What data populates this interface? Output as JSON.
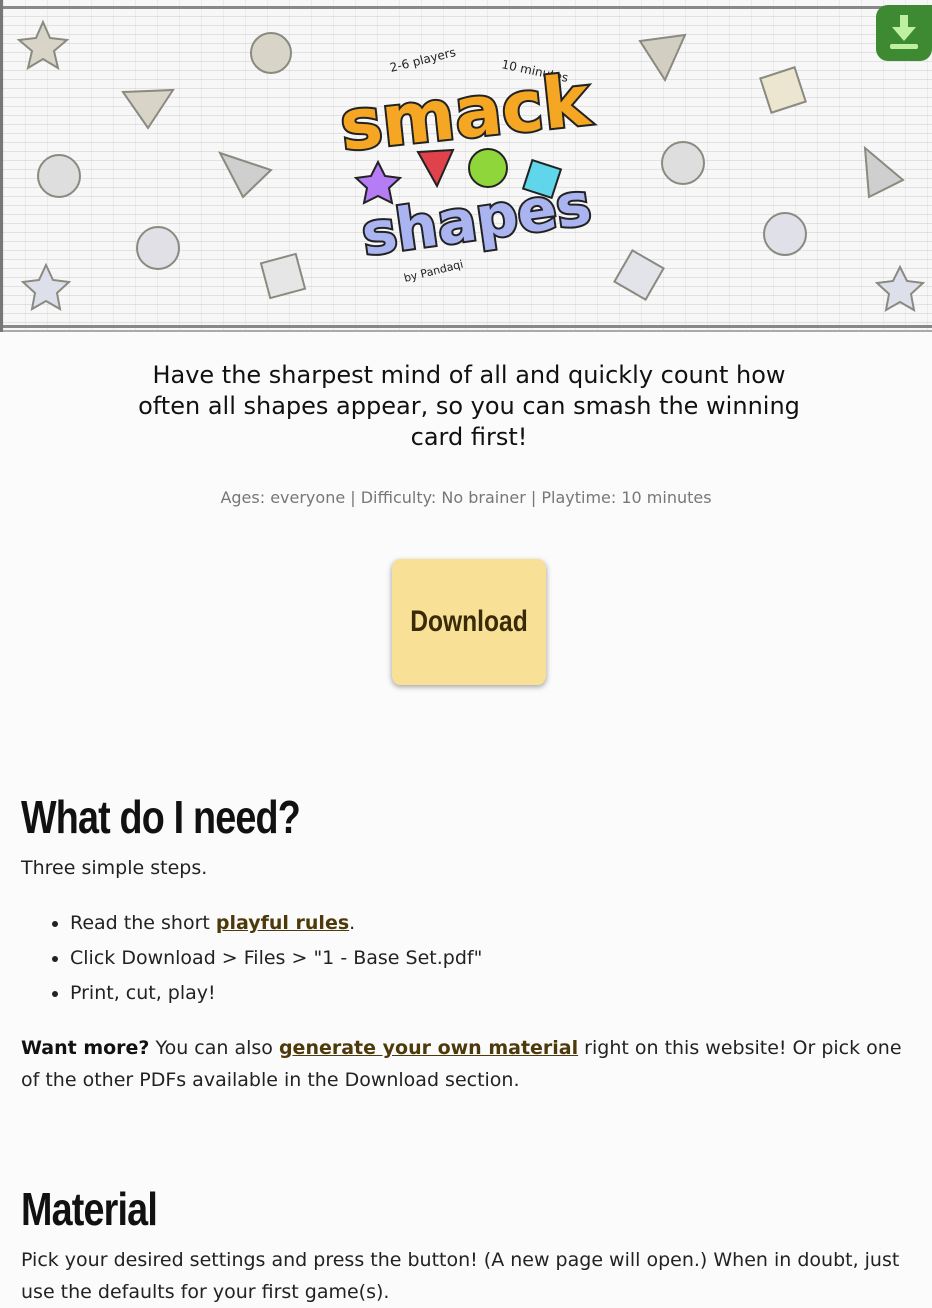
{
  "header": {
    "logo": {
      "word1": "smack",
      "word2": "shapes",
      "players": "2-6 players",
      "time": "10 minutes",
      "byline": "by Pandaqi"
    },
    "download_corner_icon": "download-arrow-icon"
  },
  "intro_text": "Have the sharpest mind of all and quickly count how often all shapes appear, so you can smash the winning card first!",
  "meta_line": "Ages: everyone | Difficulty: No brainer | Playtime: 10 minutes",
  "download_button": "Download",
  "section_need": {
    "heading": "What do I need?",
    "subtitle": "Three simple steps.",
    "steps": {
      "s1_before": "Read the short ",
      "s1_link": "playful rules",
      "s1_after": ".",
      "s2": "Click Download > Files > \"1 - Base Set.pdf\"",
      "s3": "Print, cut, play!"
    },
    "more_bold": "Want more?",
    "more_before": " You can also ",
    "more_link": "generate your own material",
    "more_after": " right on this website! Or pick one of the other PDFs available in the Download section."
  },
  "section_material": {
    "heading": "Material",
    "text": "Pick your desired settings and press the button! (A new page will open.) When in doubt, just use the defaults for your first game(s)."
  },
  "colors": {
    "accent": "#f8e097",
    "link": "#4d3a0a",
    "corner": "#3e8a32"
  }
}
